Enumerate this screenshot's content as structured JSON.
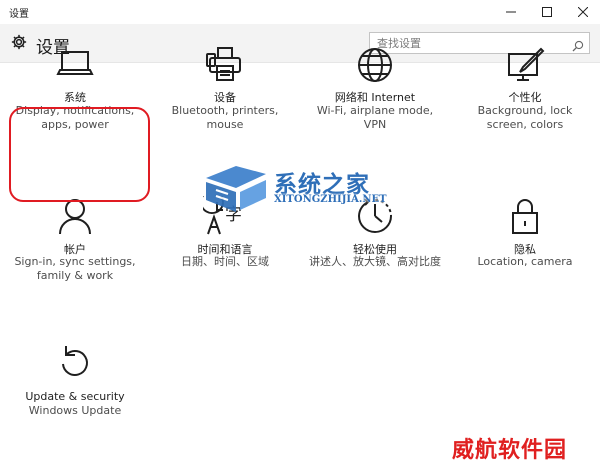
{
  "window": {
    "title": "设置"
  },
  "header": {
    "title": "设置",
    "search_placeholder": "查找设置"
  },
  "tiles": [
    {
      "name": "系统",
      "desc": "Display, notifications, apps, power",
      "icon": "laptop-icon"
    },
    {
      "name": "设备",
      "desc": "Bluetooth, printers, mouse",
      "icon": "printer-icon"
    },
    {
      "name": "网络和 Internet",
      "desc": "Wi-Fi, airplane mode, VPN",
      "icon": "globe-icon"
    },
    {
      "name": "个性化",
      "desc": "Background, lock screen, colors",
      "icon": "personalization-icon"
    },
    {
      "name": "帐户",
      "desc": "Sign-in, sync settings, family & work",
      "icon": "person-icon"
    },
    {
      "name": "时间和语言",
      "desc": "日期、时间、区域",
      "icon": "time-language-icon"
    },
    {
      "name": "轻松使用",
      "desc": "讲述人、放大镜、高对比度",
      "icon": "ease-of-access-icon"
    },
    {
      "name": "隐私",
      "desc": "Location, camera",
      "icon": "lock-icon"
    },
    {
      "name": "Update & security",
      "desc": "Windows Update",
      "icon": "update-icon"
    }
  ],
  "watermarks": {
    "center": "系统之家",
    "center_sub": "XITONGZHIJIA.NET",
    "corner": "威航软件园"
  },
  "colors": {
    "accent": "#1f4f8a",
    "highlight": "#e01b22",
    "header_bg": "#f3f3f3"
  }
}
